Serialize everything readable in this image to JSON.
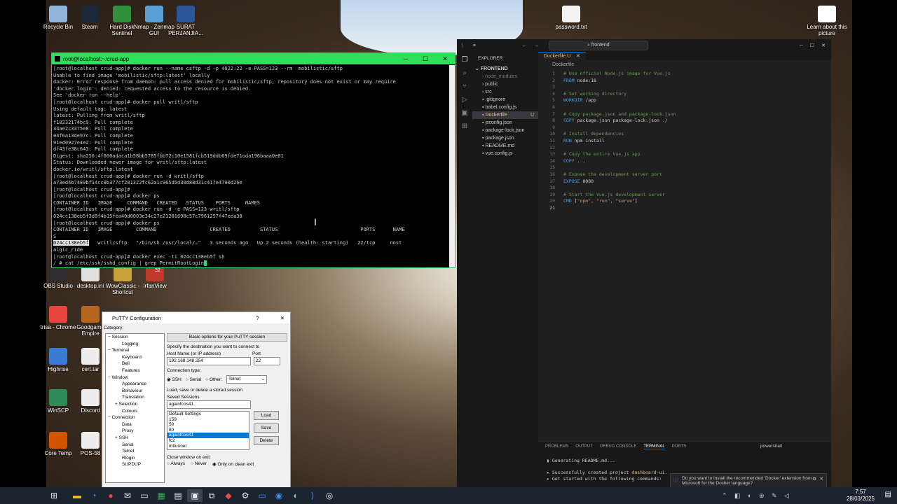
{
  "desktop": {
    "icons": [
      {
        "label": "Recycle Bin",
        "color": "#8fb3d9"
      },
      {
        "label": "Steam",
        "color": "#1b2838"
      },
      {
        "label": "Hard Disk Sentinel",
        "color": "#2f8f3a"
      },
      {
        "label": "Nmap - Zenmap GUI",
        "color": "#5a9fd4"
      },
      {
        "label": "SURAT PERJANJIA...",
        "color": "#2b579a"
      },
      {
        "label": "password.txt",
        "color": "#f2f2f2"
      },
      {
        "label": "Learn about this picture",
        "color": "#ffffff"
      },
      {
        "label": "OBS Studio",
        "color": "#302e31"
      },
      {
        "label": "desktop.ini",
        "color": "#e0e0e0"
      },
      {
        "label": "WowClassic - Shortcut",
        "color": "#c9a23c"
      },
      {
        "label": "IrfanView",
        "color": "#c0392b"
      },
      {
        "label": "trisa - Chrome",
        "color": "#e8453c"
      },
      {
        "label": "Goodgame Empire",
        "color": "#b5651d"
      },
      {
        "label": "Highrise",
        "color": "#3a7bd5"
      },
      {
        "label": "cert.tar",
        "color": "#ededed"
      },
      {
        "label": "WinSCP",
        "color": "#2e8b57"
      },
      {
        "label": "Discord",
        "color": "#ededed"
      },
      {
        "label": "Core Temp",
        "color": "#d35400"
      },
      {
        "label": "POS-58",
        "color": "#ededed"
      }
    ],
    "irfan_badge": "32"
  },
  "terminal": {
    "title": "root@localhost:~/crud-app",
    "lines": [
      "[root@localhost crud-app]# docker run --name csftp -d -p 4022:22 -e PASS=123 --rm  mobilistic/sftp",
      "Unable to find image 'mobilistic/sftp:latest' locally",
      "docker: Error response from daemon: pull access denied for mobilistic/sftp, repository does not exist or may require",
      "'docker login': denied: requested access to the resource is denied.",
      "See 'docker run --help'.",
      "[root@localhost crud-app]# docker pull writl/sftp",
      "Using default tag: latest",
      "latest: Pulling from writl/sftp",
      "f18232174bc9: Pull complete",
      "34ae2c3375e8: Pull complete",
      "04f6a13de97c: Pull complete",
      "91ed0927e4e2: Pull complete",
      "df43fe38c643: Pull complete",
      "Digest: sha256:4f600adaca1b58bb5785fbb72c10e1581fcb519ddb69fde71oda196baaa0e01",
      "Status: Downloaded newer image for writl/sftp:latest",
      "docker.io/writl/sftp:latest",
      "[root@localhost crud-app]# docker run -d writl/sftp",
      "a73ed4b7489bf14cc0b377cf201322fc62a1c965d5d30d88d31c417e4790d26e",
      "[root@localhost crud-app]#",
      "[root@localhost crud-app]# docker ps",
      "CONTAINER ID   IMAGE     COMMAND   CREATED   STATUS    PORTS     NAMES",
      "[root@localhost crud-app]# docker run -d -e PASS=123 writl/sftp",
      "024cc138eb5f3d8f4b15fea40d0003e34c27e21281698c57c7961257f47eea38",
      "[root@localhost crud-app]# docker ps",
      "CONTAINER ID   IMAGE        COMMAND                  CREATED          STATUS                            PORTS      NAME",
      "S",
      "024cc138eb5f   writl/sftp   \"/bin/sh /usr/local/…\"   3 seconds ago   Up 2 seconds (health: starting)   22/tcp     nost",
      "algic_ride",
      "[root@localhost crud-app]# docker exec -ti 024cc138eb5f sh",
      "/ # cat /etc/ssh/sshd_config | grep PermitRootLogin"
    ],
    "highlight_id": "024cc138eb5f"
  },
  "putty": {
    "title": "PuTTY Configuration",
    "help": "?",
    "category_label": "Category:",
    "tree": [
      {
        "label": "Session",
        "depth": 0,
        "exp": "−"
      },
      {
        "label": "Logging",
        "depth": 2,
        "exp": ""
      },
      {
        "label": "Terminal",
        "depth": 0,
        "exp": "−"
      },
      {
        "label": "Keyboard",
        "depth": 2,
        "exp": ""
      },
      {
        "label": "Bell",
        "depth": 2,
        "exp": ""
      },
      {
        "label": "Features",
        "depth": 2,
        "exp": ""
      },
      {
        "label": "Window",
        "depth": 0,
        "exp": "−"
      },
      {
        "label": "Appearance",
        "depth": 2,
        "exp": ""
      },
      {
        "label": "Behaviour",
        "depth": 2,
        "exp": ""
      },
      {
        "label": "Translation",
        "depth": 2,
        "exp": ""
      },
      {
        "label": "Selection",
        "depth": 1,
        "exp": "+"
      },
      {
        "label": "Colours",
        "depth": 2,
        "exp": ""
      },
      {
        "label": "Connection",
        "depth": 0,
        "exp": "−"
      },
      {
        "label": "Data",
        "depth": 2,
        "exp": ""
      },
      {
        "label": "Proxy",
        "depth": 2,
        "exp": ""
      },
      {
        "label": "SSH",
        "depth": 1,
        "exp": "+"
      },
      {
        "label": "Serial",
        "depth": 2,
        "exp": ""
      },
      {
        "label": "Telnet",
        "depth": 2,
        "exp": ""
      },
      {
        "label": "Rlogin",
        "depth": 2,
        "exp": ""
      },
      {
        "label": "SUPDUP",
        "depth": 2,
        "exp": ""
      }
    ],
    "header_button": "Basic options for your PuTTY session",
    "dest_label": "Specify the destination you want to connect to",
    "host_label": "Host Name (or IP address)",
    "host_value": "192.168.148.254",
    "port_label": "Port",
    "port_value": "22",
    "conn_type_label": "Connection type:",
    "conn_types": [
      "SSH",
      "Serial",
      "Other:"
    ],
    "other_select": "Telnet",
    "sessions_section": "Load, save or delete a stored session",
    "saved_sessions_label": "Saved Sessions",
    "saved_value": "againfcos41",
    "session_list": [
      "Default Settings",
      "159",
      "50",
      "80",
      "againfcos41",
      "fc2",
      "mttunnel"
    ],
    "selected_session": "againfcos41",
    "load": "Load",
    "save": "Save",
    "delete": "Delete",
    "close_label": "Close window on exit:",
    "close_options": [
      "Always",
      "Never",
      "Only on clean exit"
    ]
  },
  "vscode": {
    "search": "frontend",
    "explorer_title": "EXPLORER",
    "root": "FRONTEND",
    "files": [
      {
        "name": "node_modules",
        "type": "folder",
        "dim": true
      },
      {
        "name": "public",
        "type": "folder",
        "dim": false
      },
      {
        "name": "src",
        "type": "folder",
        "dim": false
      },
      {
        "name": ".gitignore",
        "type": "file",
        "dim": false
      },
      {
        "name": "babel.config.js",
        "type": "file",
        "dim": false
      },
      {
        "name": "Dockerfile",
        "type": "file",
        "dim": false,
        "active": true,
        "badge": "U"
      },
      {
        "name": "jsconfig.json",
        "type": "file",
        "dim": false
      },
      {
        "name": "package-lock.json",
        "type": "file",
        "dim": false
      },
      {
        "name": "package.json",
        "type": "file",
        "dim": false
      },
      {
        "name": "README.md",
        "type": "file",
        "dim": false
      },
      {
        "name": "vue.config.js",
        "type": "file",
        "dim": false
      }
    ],
    "tab": "Dockerfile U",
    "breadcrumb": "Dockerfile",
    "code": [
      [
        [
          "cm",
          "# Use official Node.js image for Vue.js"
        ]
      ],
      [
        [
          "kw",
          "FROM"
        ],
        [
          "",
          " node:18"
        ]
      ],
      [],
      [
        [
          "cm",
          "# Set working directory"
        ]
      ],
      [
        [
          "kw",
          "WORKDIR"
        ],
        [
          "",
          " /app"
        ]
      ],
      [],
      [
        [
          "cm",
          "# Copy package.json and package-lock.json"
        ]
      ],
      [
        [
          "kw",
          "COPY"
        ],
        [
          "",
          " package.json package-lock.json ./"
        ]
      ],
      [],
      [
        [
          "cm",
          "# Install dependencies"
        ]
      ],
      [
        [
          "kw",
          "RUN"
        ],
        [
          "",
          " npm install"
        ]
      ],
      [],
      [
        [
          "cm",
          "# Copy the entire Vue.js app"
        ]
      ],
      [
        [
          "kw",
          "COPY"
        ],
        [
          "",
          " . ."
        ]
      ],
      [],
      [
        [
          "cm",
          "# Expose the development server port"
        ]
      ],
      [
        [
          "kw",
          "EXPOSE"
        ],
        [
          "",
          " 8080"
        ]
      ],
      [],
      [
        [
          "cm",
          "# Start the Vue.js development server"
        ]
      ],
      [
        [
          "kw",
          "CMD"
        ],
        [
          "",
          " ["
        ],
        [
          "st",
          "\"npm\""
        ],
        [
          "",
          ", "
        ],
        [
          "st",
          "\"run\""
        ],
        [
          "",
          ", "
        ],
        [
          "st",
          "\"serve\""
        ],
        [
          "",
          "]"
        ]
      ],
      []
    ],
    "panel_tabs": [
      "PROBLEMS",
      "OUTPUT",
      "DEBUG CONSOLE",
      "TERMINAL",
      "PORTS"
    ],
    "active_panel_tab": "TERMINAL",
    "shell": "powershell",
    "panel_lines": [
      {
        "prefix": "",
        "text": "Generating README.md..."
      },
      {
        "prefix": "",
        "text": "Successfully created project "
      },
      {
        "prefix": "",
        "text": "Get started with the following commands:"
      }
    ],
    "project_name": "dashboard-ui.",
    "notification": "Do you want to install the recommended 'Docker' extension from Microsoft for the Docker language?"
  },
  "taskbar": {
    "time": "7:57",
    "date": "28/03/2025"
  }
}
